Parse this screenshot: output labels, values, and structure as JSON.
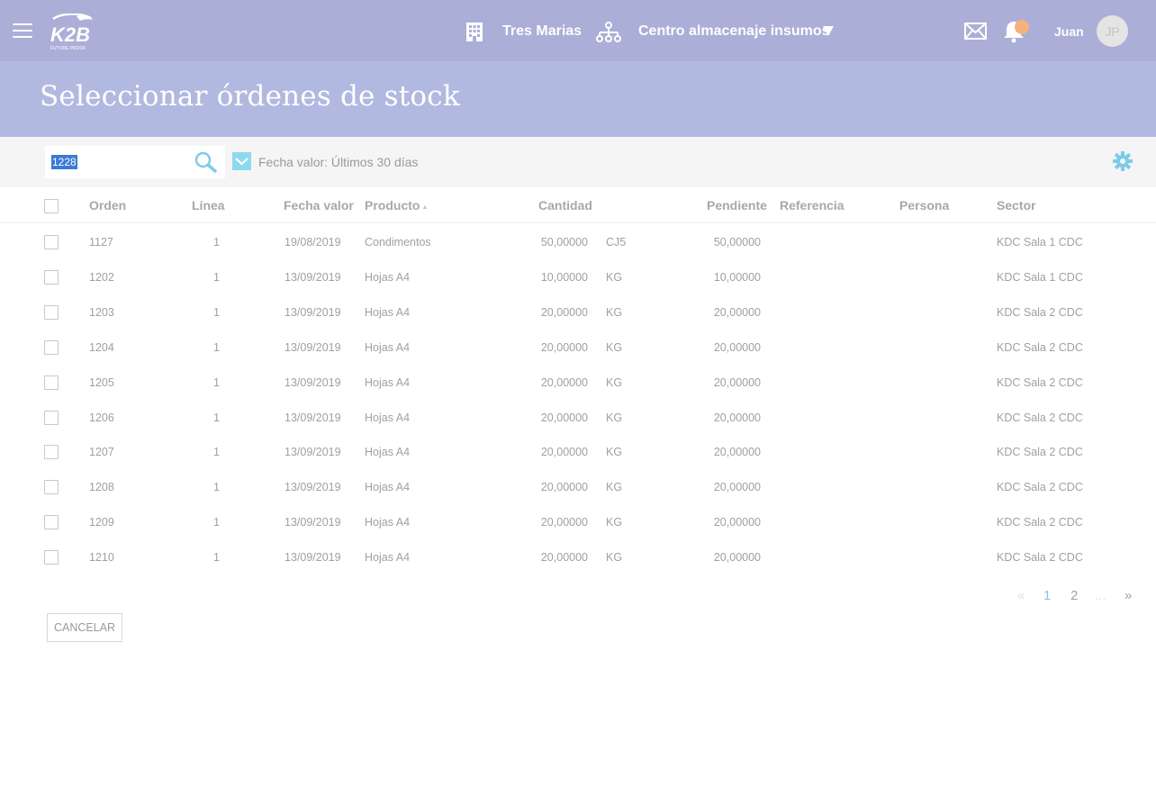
{
  "header": {
    "company": "Tres Marias",
    "warehouse": "Centro almacenaje insumos",
    "user_name": "Juan",
    "user_initials": "JP",
    "logo_text": "K2B",
    "logo_tagline": "FUTURE PROOF",
    "accent_color": "#abaed6",
    "notification_color": "#f5b17e"
  },
  "page": {
    "title": "Seleccionar órdenes de stock"
  },
  "filters": {
    "search_value": "1228",
    "date_filter_label": "Fecha valor: Últimos 30 días",
    "date_filter_checked": true
  },
  "table": {
    "columns": {
      "orden": "Orden",
      "linea": "Línea",
      "fecha": "Fecha valor",
      "producto": "Producto",
      "cantidad": "Cantidad",
      "pendiente": "Pendiente",
      "referencia": "Referencia",
      "persona": "Persona",
      "sector": "Sector"
    },
    "sort_indicator": "▲",
    "rows": [
      {
        "orden": "1127",
        "linea": "1",
        "fecha": "19/08/2019",
        "producto": "Condimentos",
        "cantidad": "50,00000",
        "unidad": "CJ5",
        "pendiente": "50,00000",
        "referencia": "",
        "persona": "",
        "sector": "KDC Sala 1 CDC"
      },
      {
        "orden": "1202",
        "linea": "1",
        "fecha": "13/09/2019",
        "producto": "Hojas A4",
        "cantidad": "10,00000",
        "unidad": "KG",
        "pendiente": "10,00000",
        "referencia": "",
        "persona": "",
        "sector": "KDC Sala 1 CDC"
      },
      {
        "orden": "1203",
        "linea": "1",
        "fecha": "13/09/2019",
        "producto": "Hojas A4",
        "cantidad": "20,00000",
        "unidad": "KG",
        "pendiente": "20,00000",
        "referencia": "",
        "persona": "",
        "sector": "KDC Sala 2 CDC"
      },
      {
        "orden": "1204",
        "linea": "1",
        "fecha": "13/09/2019",
        "producto": "Hojas A4",
        "cantidad": "20,00000",
        "unidad": "KG",
        "pendiente": "20,00000",
        "referencia": "",
        "persona": "",
        "sector": "KDC Sala 2 CDC"
      },
      {
        "orden": "1205",
        "linea": "1",
        "fecha": "13/09/2019",
        "producto": "Hojas A4",
        "cantidad": "20,00000",
        "unidad": "KG",
        "pendiente": "20,00000",
        "referencia": "",
        "persona": "",
        "sector": "KDC Sala 2 CDC"
      },
      {
        "orden": "1206",
        "linea": "1",
        "fecha": "13/09/2019",
        "producto": "Hojas A4",
        "cantidad": "20,00000",
        "unidad": "KG",
        "pendiente": "20,00000",
        "referencia": "",
        "persona": "",
        "sector": "KDC Sala 2 CDC"
      },
      {
        "orden": "1207",
        "linea": "1",
        "fecha": "13/09/2019",
        "producto": "Hojas A4",
        "cantidad": "20,00000",
        "unidad": "KG",
        "pendiente": "20,00000",
        "referencia": "",
        "persona": "",
        "sector": "KDC Sala 2 CDC"
      },
      {
        "orden": "1208",
        "linea": "1",
        "fecha": "13/09/2019",
        "producto": "Hojas A4",
        "cantidad": "20,00000",
        "unidad": "KG",
        "pendiente": "20,00000",
        "referencia": "",
        "persona": "",
        "sector": "KDC Sala 2 CDC"
      },
      {
        "orden": "1209",
        "linea": "1",
        "fecha": "13/09/2019",
        "producto": "Hojas A4",
        "cantidad": "20,00000",
        "unidad": "KG",
        "pendiente": "20,00000",
        "referencia": "",
        "persona": "",
        "sector": "KDC Sala 2 CDC"
      },
      {
        "orden": "1210",
        "linea": "1",
        "fecha": "13/09/2019",
        "producto": "Hojas A4",
        "cantidad": "20,00000",
        "unidad": "KG",
        "pendiente": "20,00000",
        "referencia": "",
        "persona": "",
        "sector": "KDC Sala 2 CDC"
      }
    ]
  },
  "pagination": {
    "prev": "«",
    "pages": [
      "1",
      "2"
    ],
    "current": "1",
    "ellipsis": "...",
    "next": "»"
  },
  "actions": {
    "cancel_label": "CANCELAR"
  },
  "icons": {
    "menu": "hamburger-icon",
    "company": "building-icon",
    "warehouse": "org-tree-icon",
    "mail": "mail-icon",
    "notifications": "bell-icon",
    "search": "search-icon",
    "settings": "gear-icon"
  }
}
